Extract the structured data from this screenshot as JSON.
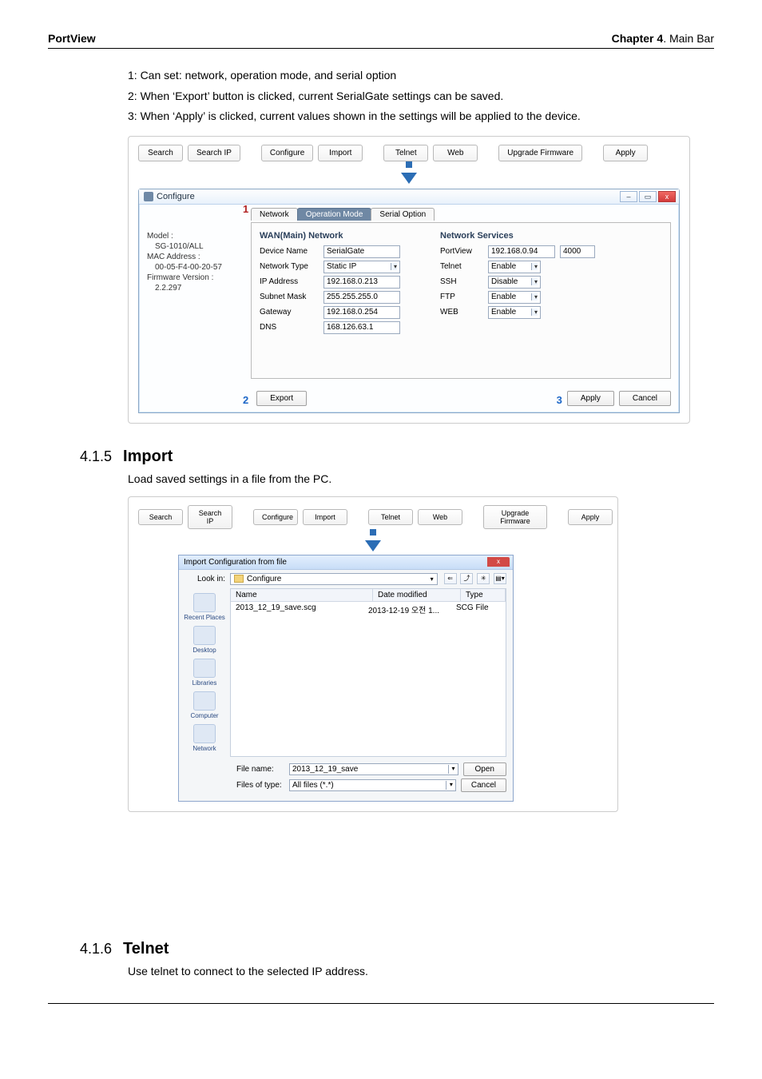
{
  "header": {
    "left": "PortView",
    "right_bold": "Chapter 4",
    "right_rest": ". Main Bar"
  },
  "intro": {
    "l1": "1: Can set: network, operation mode, and serial option",
    "l2": "2: When ‘Export’ button is clicked, current SerialGate settings can be saved.",
    "l3": "3: When ‘Apply’ is clicked, current values shown in the settings will be applied to the device."
  },
  "toolbar": {
    "search": "Search",
    "searchip": "Search IP",
    "configure": "Configure",
    "import": "Import",
    "telnet": "Telnet",
    "web": "Web",
    "upgrade": "Upgrade Firmware",
    "apply": "Apply"
  },
  "configure": {
    "title": "Configure",
    "tabs": {
      "network": "Network",
      "opmode": "Operation Mode",
      "serial": "Serial Option"
    },
    "annot": {
      "one": "1",
      "two": "2",
      "three": "3"
    },
    "left": {
      "model_lbl": "Model :",
      "model_val": "SG-1010/ALL",
      "mac_lbl": "MAC Address :",
      "mac_val": "00-05-F4-00-20-57",
      "fw_lbl": "Firmware Version :",
      "fw_val": "2.2.297"
    },
    "wan": {
      "heading": "WAN(Main) Network",
      "devname_k": "Device Name",
      "devname_v": "SerialGate",
      "nettype_k": "Network Type",
      "nettype_v": "Static IP",
      "ip_k": "IP Address",
      "ip_v": "192.168.0.213",
      "mask_k": "Subnet Mask",
      "mask_v": "255.255.255.0",
      "gw_k": "Gateway",
      "gw_v": "192.168.0.254",
      "dns_k": "DNS",
      "dns_v": "168.126.63.1"
    },
    "svc": {
      "heading": "Network Services",
      "pv_k": "PortView",
      "pv_ip": "192.168.0.94",
      "pv_port": "4000",
      "telnet_k": "Telnet",
      "telnet_v": "Enable",
      "ssh_k": "SSH",
      "ssh_v": "Disable",
      "ftp_k": "FTP",
      "ftp_v": "Enable",
      "web_k": "WEB",
      "web_v": "Enable"
    },
    "buttons": {
      "export": "Export",
      "apply": "Apply",
      "cancel": "Cancel"
    }
  },
  "sec_import": {
    "num": "4.1.5",
    "title": "Import",
    "desc": "Load saved settings in a file from the PC."
  },
  "filedlg": {
    "title": "Import Configuration from file",
    "lookin_lbl": "Look in:",
    "lookin_val": "Configure",
    "cols": {
      "name": "Name",
      "date": "Date modified",
      "type": "Type"
    },
    "item": {
      "name": "2013_12_19_save.scg",
      "date": "2013-12-19 오전 1...",
      "type": "SCG File"
    },
    "places": {
      "recent": "Recent Places",
      "desktop": "Desktop",
      "libraries": "Libraries",
      "computer": "Computer",
      "network": "Network"
    },
    "fname_lbl": "File name:",
    "fname_val": "2013_12_19_save",
    "ftype_lbl": "Files of type:",
    "ftype_val": "All files (*.*)",
    "open": "Open",
    "cancel": "Cancel"
  },
  "sec_telnet": {
    "num": "4.1.6",
    "title": "Telnet",
    "desc": "Use telnet to connect to the selected IP address."
  }
}
